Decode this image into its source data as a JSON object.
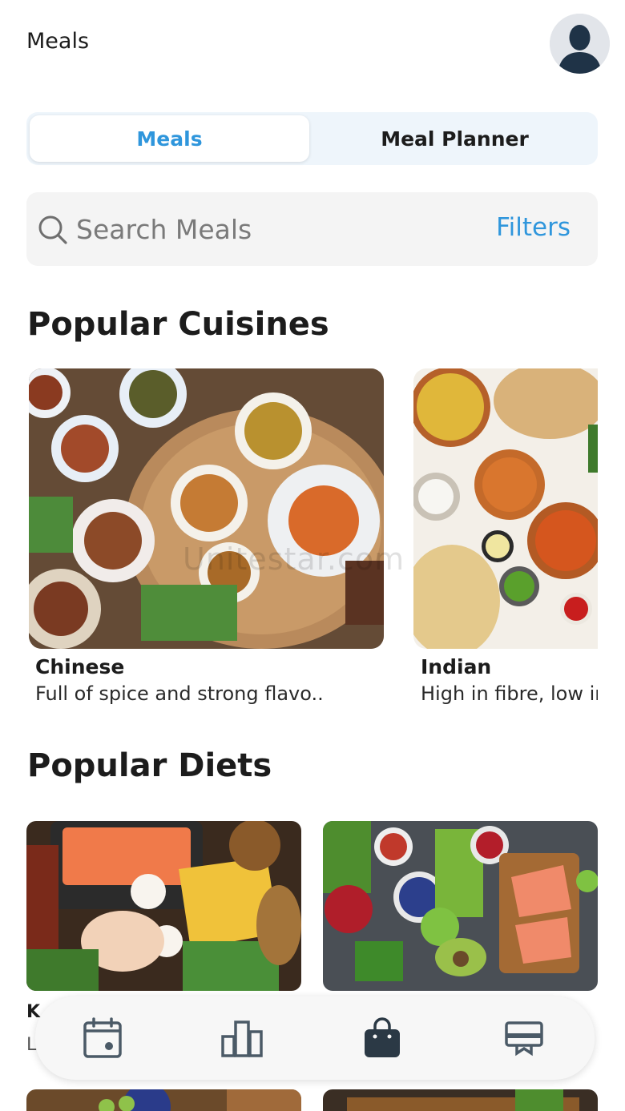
{
  "header": {
    "title": "Meals",
    "avatar_icon": "user-avatar-icon"
  },
  "tabs": [
    {
      "label": "Meals",
      "active": true
    },
    {
      "label": "Meal Planner",
      "active": false
    }
  ],
  "search": {
    "placeholder": "Search Meals",
    "value": "",
    "filters_label": "Filters",
    "icon": "search-icon"
  },
  "cuisines": {
    "title": "Popular Cuisines",
    "items": [
      {
        "name": "Chinese",
        "description": "Full of spice and strong flavo.."
      },
      {
        "name": "Indian",
        "description": "High in fibre, low in"
      }
    ]
  },
  "diets": {
    "title": "Popular Diets",
    "items": [
      {
        "name": "K",
        "description": "L"
      },
      {
        "name": "",
        "description": ""
      }
    ]
  },
  "watermark": "Unitestar.com",
  "bottom_nav": {
    "items": [
      {
        "icon": "calendar-icon",
        "active": false
      },
      {
        "icon": "bar-chart-icon",
        "active": false
      },
      {
        "icon": "shopping-bag-icon",
        "active": true
      },
      {
        "icon": "monitor-icon",
        "active": false
      }
    ]
  },
  "colors": {
    "accent": "#2f96dc",
    "text": "#1c1c1c",
    "tab_track": "#eef5fb",
    "search_bg": "#f4f4f4"
  }
}
